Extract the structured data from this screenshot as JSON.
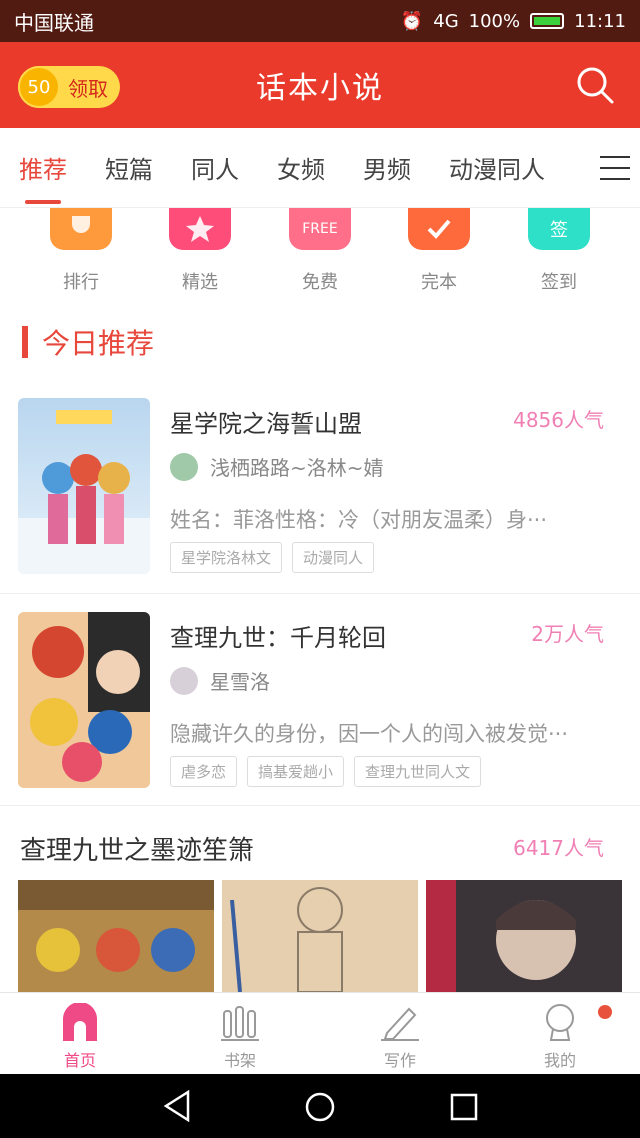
{
  "status_bar": {
    "carrier": "中国联通",
    "signal": "4G",
    "battery": "100%",
    "time": "11:11"
  },
  "header": {
    "title": "话本小说",
    "coin_count": "50",
    "coin_label": "领取"
  },
  "tabs": [
    {
      "label": "推荐",
      "active": true
    },
    {
      "label": "短篇",
      "active": false
    },
    {
      "label": "同人",
      "active": false
    },
    {
      "label": "女频",
      "active": false
    },
    {
      "label": "男频",
      "active": false
    },
    {
      "label": "动漫同人",
      "active": false
    }
  ],
  "quick_links": [
    {
      "label": "排行",
      "icon": "trophy-icon",
      "color": "#ff9a3c"
    },
    {
      "label": "精选",
      "icon": "star-icon",
      "color": "#ff4d79"
    },
    {
      "label": "免费",
      "icon": "free-icon",
      "color": "#ff6f8a",
      "badge": "FREE"
    },
    {
      "label": "完本",
      "icon": "check-icon",
      "color": "#ff6a3c"
    },
    {
      "label": "签到",
      "icon": "sign-in-icon",
      "color": "#2ee0c8",
      "badge": "签"
    }
  ],
  "section": {
    "title": "今日推荐"
  },
  "books": [
    {
      "title": "星学院之海誓山盟",
      "popularity": "4856人气",
      "author": "浅栖路路~洛林~婧",
      "description": "姓名：菲洛性格：冷（对朋友温柔）身···",
      "tags": [
        "星学院洛林文",
        "动漫同人"
      ],
      "cover_color": "#c9e1f3",
      "avatar_color": "#9fc9a9"
    },
    {
      "title": "查理九世：千月轮回",
      "popularity": "2万人气",
      "author": "星雪洛",
      "description": "隐藏许久的身份，因一个人的闯入被发觉···",
      "tags": [
        "虐多恋",
        "搞基爱趟小",
        "查理九世同人文"
      ],
      "cover_color": "#d58a58",
      "avatar_color": "#d8d0d8"
    }
  ],
  "collection": {
    "title": "查理九世之墨迹笙箫",
    "popularity": "6417人气"
  },
  "bottom_nav": [
    {
      "label": "首页",
      "icon": "home-icon",
      "active": true
    },
    {
      "label": "书架",
      "icon": "bookshelf-icon",
      "active": false
    },
    {
      "label": "写作",
      "icon": "write-icon",
      "active": false
    },
    {
      "label": "我的",
      "icon": "profile-icon",
      "active": false
    }
  ],
  "colors": {
    "accent": "#ea3a2b",
    "popularity": "#f07fb4",
    "nav_active": "#f04a86"
  }
}
